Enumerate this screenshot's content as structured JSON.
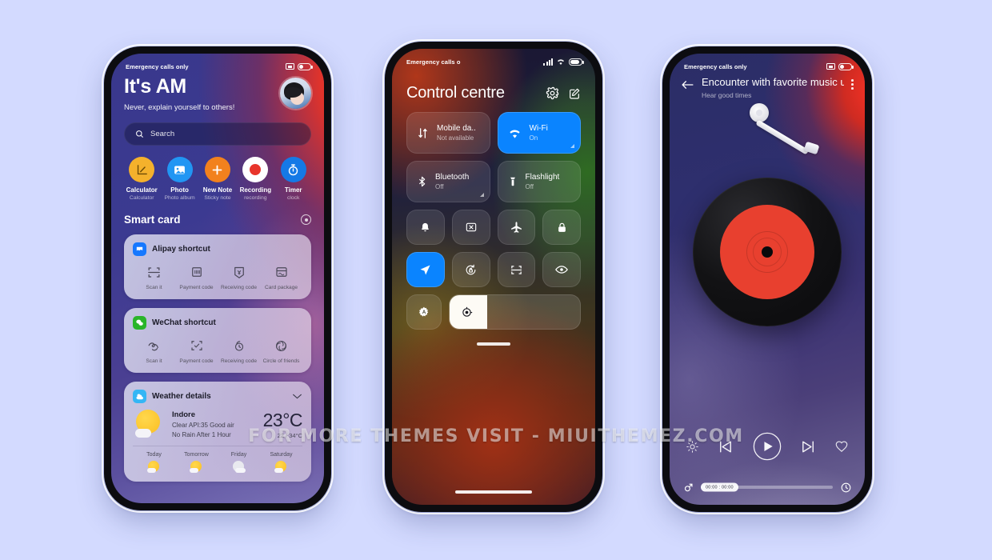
{
  "page": {
    "background_color": "#d3daff",
    "watermark": "FOR MORE THEMES VISIT - MIUITHEMEZ.COM"
  },
  "phone1": {
    "statusbar": {
      "carrier": "Emergency calls only",
      "cast_icon": "cast-icon",
      "battery_icon": "battery-icon"
    },
    "greeting": {
      "title": "It's AM",
      "subtitle": "Never, explain yourself to others!"
    },
    "search": {
      "placeholder": "Search",
      "icon": "search-icon"
    },
    "apps": [
      {
        "name": "Calculator",
        "sub": "Calculator",
        "icon": "calculator-icon",
        "color": "#f4b12c"
      },
      {
        "name": "Photo",
        "sub": "Photo album",
        "icon": "photo-icon",
        "color": "#2196f3"
      },
      {
        "name": "New Note",
        "sub": "Sticky note",
        "icon": "plus-icon",
        "color": "#f2811d"
      },
      {
        "name": "Recording",
        "sub": "recording",
        "icon": "record-icon",
        "color": "#ffffff"
      },
      {
        "name": "Timer",
        "sub": "clock",
        "icon": "timer-icon",
        "color": "#1579e6"
      }
    ],
    "smart_card": {
      "title": "Smart card",
      "settings_icon": "target-icon"
    },
    "alipay": {
      "title": "Alipay shortcut",
      "badge_color": "#1678ff",
      "items": [
        {
          "label": "Scan it",
          "icon": "scan-icon"
        },
        {
          "label": "Payment code",
          "icon": "barcode-icon"
        },
        {
          "label": "Receiving code",
          "icon": "yuan-receive-icon"
        },
        {
          "label": "Card package",
          "icon": "card-package-icon"
        }
      ]
    },
    "wechat": {
      "title": "WeChat shortcut",
      "badge_color": "#2ab52a",
      "items": [
        {
          "label": "Scan it",
          "icon": "wechat-scan-icon"
        },
        {
          "label": "Payment code",
          "icon": "qr-check-icon"
        },
        {
          "label": "Receiving code",
          "icon": "wallet-clock-icon"
        },
        {
          "label": "Circle of friends",
          "icon": "moments-icon"
        }
      ]
    },
    "weather": {
      "title": "Weather details",
      "badge_color": "#34b6f5",
      "chevron": "chevron-down-icon",
      "city": "Indore",
      "condition": "Clear API:35 Good air",
      "rain": "No Rain After 1 Hour",
      "temp": "23°C",
      "range": "22 / 34°C",
      "forecast": [
        {
          "day": "Today",
          "icon": "sun-cloud-icon"
        },
        {
          "day": "Tomorrow",
          "icon": "sun-cloud-icon"
        },
        {
          "day": "Friday",
          "icon": "cloud-icon"
        },
        {
          "day": "Saturday",
          "icon": "sun-cloud-icon"
        }
      ]
    }
  },
  "phone2": {
    "statusbar": {
      "carrier": "Emergency calls o",
      "signal_icon": "signal-icon",
      "wifi_icon": "wifi-icon",
      "battery_icon": "battery-icon"
    },
    "title": "Control centre",
    "actions": [
      {
        "name": "settings",
        "icon": "gear-icon"
      },
      {
        "name": "edit",
        "icon": "edit-icon"
      }
    ],
    "tiles": [
      {
        "name": "Mobile da..",
        "status": "Not available",
        "icon": "mobile-data-icon",
        "on": false,
        "expandable": false
      },
      {
        "name": "Wi-Fi",
        "status": "On",
        "icon": "wifi-icon",
        "on": true,
        "expandable": true
      },
      {
        "name": "Bluetooth",
        "status": "Off",
        "icon": "bluetooth-icon",
        "on": false,
        "expandable": true
      },
      {
        "name": "Flashlight",
        "status": "Off",
        "icon": "flashlight-icon",
        "on": false,
        "expandable": false
      }
    ],
    "toggles": [
      {
        "name": "silent",
        "icon": "bell-icon",
        "on": false
      },
      {
        "name": "cast",
        "icon": "cast-screen-icon",
        "on": false
      },
      {
        "name": "airplane-mode",
        "icon": "airplane-icon",
        "on": false
      },
      {
        "name": "lock",
        "icon": "lock-icon",
        "on": false
      },
      {
        "name": "location",
        "icon": "location-arrow-icon",
        "on": true
      },
      {
        "name": "rotation-lock",
        "icon": "rotation-lock-icon",
        "on": false
      },
      {
        "name": "scanner",
        "icon": "scan-frame-icon",
        "on": false
      },
      {
        "name": "eye-care",
        "icon": "eye-icon",
        "on": false
      }
    ],
    "bottom": {
      "auto_brightness": {
        "name": "auto-brightness",
        "icon": "brightness-auto-icon"
      },
      "slider": {
        "name": "brightness-slider",
        "icon": "brightness-dial-icon",
        "value_percent": 29
      }
    }
  },
  "phone3": {
    "statusbar": {
      "carrier": "Emergency calls only",
      "cast_icon": "cast-icon",
      "battery_icon": "battery-icon"
    },
    "header": {
      "back_icon": "back-arrow-icon",
      "title": "Encounter with favorite music un",
      "subtitle": "Hear good times",
      "menu_icon": "more-vertical-icon"
    },
    "artwork": {
      "name": "vinyl-record",
      "label_color": "#e8402f",
      "tonearm": "tonearm"
    },
    "controls": [
      {
        "name": "brightness",
        "icon": "brightness-icon"
      },
      {
        "name": "previous",
        "icon": "previous-track-icon"
      },
      {
        "name": "play",
        "icon": "play-icon"
      },
      {
        "name": "next",
        "icon": "next-track-icon"
      },
      {
        "name": "favorite",
        "icon": "heart-icon"
      }
    ],
    "progress": {
      "left_icon": "mars-icon",
      "right_icon": "timer-dial-icon",
      "time_label": "00:00 : 00:00",
      "value_percent": 2
    }
  }
}
